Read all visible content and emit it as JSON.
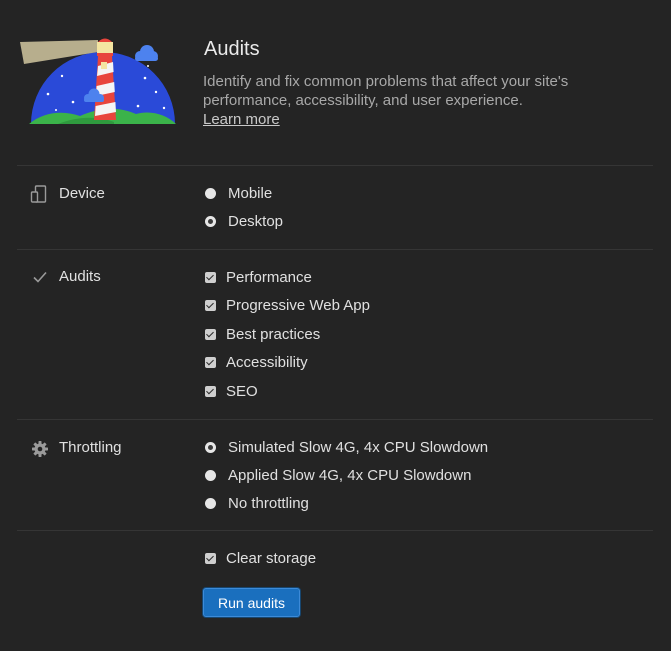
{
  "header": {
    "title": "Audits",
    "description": "Identify and fix common problems that affect your site's performance, accessibility, and user experience.",
    "learn_more": "Learn more"
  },
  "sections": {
    "device": {
      "label": "Device",
      "icon": "device-icon",
      "options": [
        {
          "label": "Mobile",
          "selected": false
        },
        {
          "label": "Desktop",
          "selected": true
        }
      ]
    },
    "audits": {
      "label": "Audits",
      "icon": "checkmark-icon",
      "options": [
        {
          "label": "Performance",
          "checked": true
        },
        {
          "label": "Progressive Web App",
          "checked": true
        },
        {
          "label": "Best practices",
          "checked": true
        },
        {
          "label": "Accessibility",
          "checked": true
        },
        {
          "label": "SEO",
          "checked": true
        }
      ]
    },
    "throttling": {
      "label": "Throttling",
      "icon": "gear-icon",
      "options": [
        {
          "label": "Simulated Slow 4G, 4x CPU Slowdown",
          "selected": true
        },
        {
          "label": "Applied Slow 4G, 4x CPU Slowdown",
          "selected": false
        },
        {
          "label": "No throttling",
          "selected": false
        }
      ]
    }
  },
  "clear_storage": {
    "label": "Clear storage",
    "checked": true
  },
  "run_button": "Run audits",
  "colors": {
    "background": "#242424",
    "button": "#1a6fbe",
    "lighthouse_sky": "#2a4ad8",
    "lighthouse_red": "#e8453c",
    "grass": "#3bb34a"
  }
}
